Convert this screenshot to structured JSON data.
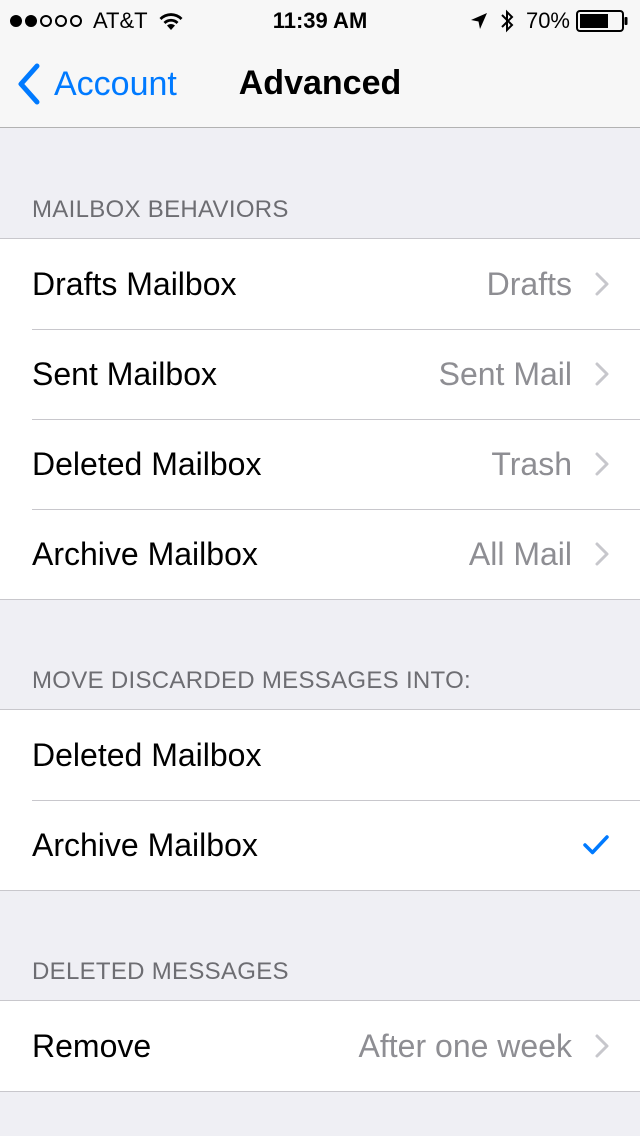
{
  "status_bar": {
    "carrier": "AT&T",
    "signal": {
      "filled": 2,
      "total": 5
    },
    "time": "11:39 AM",
    "battery_percent": "70%",
    "battery_level": 0.7,
    "icons": [
      "wifi-icon",
      "location-arrow-icon",
      "bluetooth-icon",
      "battery-icon"
    ]
  },
  "nav": {
    "back_label": "Account",
    "title": "Advanced"
  },
  "sections": [
    {
      "header": "MAILBOX BEHAVIORS",
      "rows": [
        {
          "label": "Drafts Mailbox",
          "value": "Drafts"
        },
        {
          "label": "Sent Mailbox",
          "value": "Sent Mail"
        },
        {
          "label": "Deleted Mailbox",
          "value": "Trash"
        },
        {
          "label": "Archive Mailbox",
          "value": "All Mail"
        }
      ]
    },
    {
      "header": "MOVE DISCARDED MESSAGES INTO:",
      "rows": [
        {
          "label": "Deleted Mailbox",
          "checked": false
        },
        {
          "label": "Archive Mailbox",
          "checked": true
        }
      ]
    },
    {
      "header": "DELETED MESSAGES",
      "rows": [
        {
          "label": "Remove",
          "value": "After one week"
        }
      ]
    }
  ],
  "colors": {
    "accent": "#007aff",
    "background": "#efeff4",
    "secondary_text": "#8e8e93",
    "header_text": "#6d6d72",
    "chevron": "#c7c7cc"
  }
}
